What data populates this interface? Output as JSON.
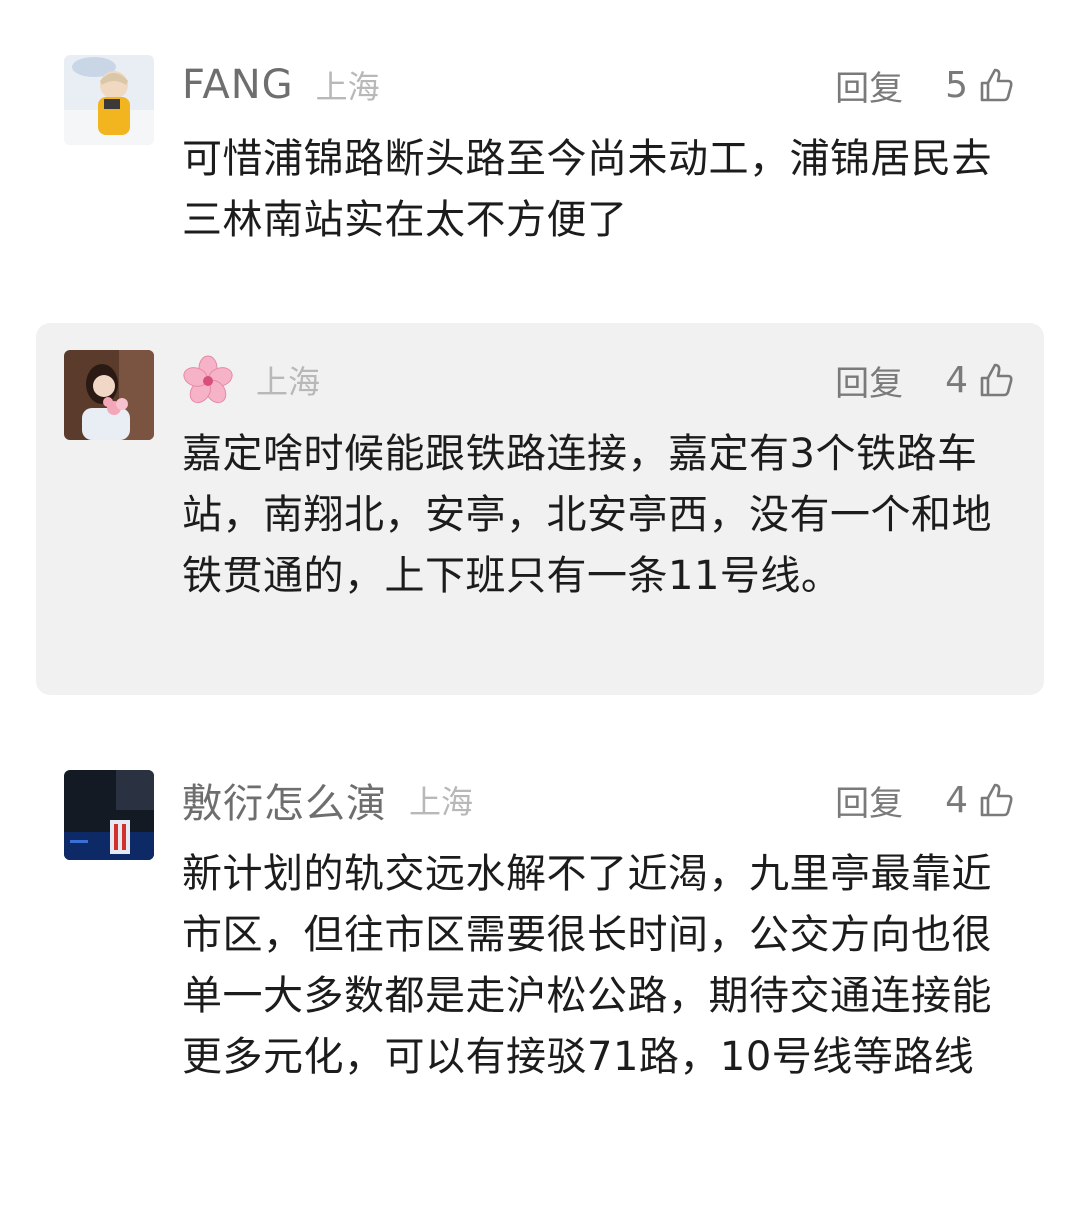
{
  "comments": [
    {
      "username": "FANG",
      "location": "上海",
      "reply_label": "回复",
      "likes": "5",
      "text": "可惜浦锦路断头路至今尚未动工，浦锦居民去三林南站实在太不方便了"
    },
    {
      "username": "",
      "location": "上海",
      "reply_label": "回复",
      "likes": "4",
      "text": "嘉定啥时候能跟铁路连接，嘉定有3个铁路车站，南翔北，安亭，北安亭西，没有一个和地铁贯通的，上下班只有一条11号线。"
    },
    {
      "username": "敷衍怎么演",
      "location": "上海",
      "reply_label": "回复",
      "likes": "4",
      "text": "新计划的轨交远水解不了近渴，九里亭最靠近市区，但往市区需要很长时间，公交方向也很单一大多数都是走沪松公路，期待交通连接能更多元化，可以有接驳71路，10号线等路线"
    }
  ],
  "icons": {
    "like": "thumbs-up-outline-icon",
    "username_emoji": "cherry-blossom-icon"
  },
  "colors": {
    "highlight_bg": "#f1f1f1",
    "meta_text": "#7a7a7a",
    "location_text": "#b8b8b8"
  }
}
